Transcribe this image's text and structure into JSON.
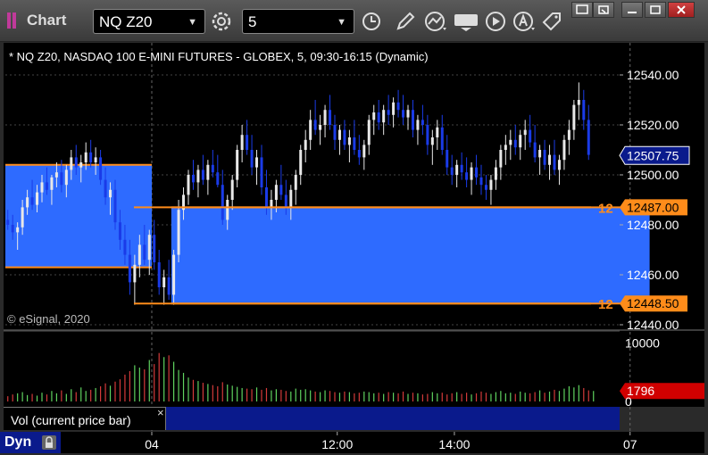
{
  "app": {
    "title": "Chart",
    "symbol": "NQ Z20",
    "interval": "5"
  },
  "chart_header": "* NQ Z20, NASDAQ 100 E-MINI FUTURES - GLOBEX, 5, 09:30-16:15 (Dynamic)",
  "copyright": "© eSignal, 2020",
  "volume_panel": {
    "label": "Vol (current price bar)",
    "close_symbol": "×"
  },
  "footer": {
    "dyn_label": "Dyn"
  },
  "colors": {
    "up": "#e8e8e8",
    "down": "#1a3be8",
    "zone": "#2e6bff",
    "level": "#ff8c1a",
    "vol_up": "#5fd35f",
    "vol_down": "#d43a3a",
    "last_price_bg": "#0a1a8c",
    "vol_badge": "#d00000"
  },
  "chart_data": {
    "type": "candlestick",
    "price_axis": {
      "ylim": [
        12440,
        12545
      ],
      "ticks": [
        "12540.00",
        "12520.00",
        "12500.00",
        "12480.00",
        "12460.00",
        "12440.00"
      ],
      "tick_values": [
        12540,
        12520,
        12500,
        12480,
        12460,
        12440
      ]
    },
    "volume_axis": {
      "ylim": [
        0,
        11000
      ],
      "ticks": [
        "10000",
        "0"
      ],
      "tick_values": [
        10000,
        0
      ]
    },
    "x_ticks": [
      {
        "label": "04",
        "index": 30
      },
      {
        "label": "12:00",
        "index": 68
      },
      {
        "label": "14:00",
        "index": 92
      },
      {
        "label": "07",
        "index": 128
      }
    ],
    "session_breaks": [
      30,
      128
    ],
    "levels": [
      {
        "tag": "12",
        "label": "12487.00",
        "value": 12487.0
      },
      {
        "tag": "12",
        "label": "12448.50",
        "value": 12448.5
      }
    ],
    "zones": [
      {
        "from": 0,
        "to": 29,
        "top": 12504,
        "bottom": 12463
      },
      {
        "from": 34,
        "to": 131,
        "top": 12487,
        "bottom": 12448.5
      }
    ],
    "last_price": {
      "label": "12507.75",
      "value": 12507.75
    },
    "last_volume": {
      "label": "1796",
      "value": 1796
    },
    "bars": [
      [
        12482,
        12486,
        12478,
        12480
      ],
      [
        12480,
        12484,
        12474,
        12477
      ],
      [
        12477,
        12481,
        12470,
        12479
      ],
      [
        12479,
        12490,
        12476,
        12487
      ],
      [
        12487,
        12494,
        12484,
        12491
      ],
      [
        12491,
        12498,
        12486,
        12488
      ],
      [
        12488,
        12496,
        12485,
        12493
      ],
      [
        12493,
        12500,
        12489,
        12497
      ],
      [
        12497,
        12503,
        12492,
        12494
      ],
      [
        12494,
        12500,
        12488,
        12499
      ],
      [
        12499,
        12505,
        12495,
        12501
      ],
      [
        12501,
        12506,
        12493,
        12496
      ],
      [
        12496,
        12504,
        12491,
        12502
      ],
      [
        12502,
        12510,
        12498,
        12507
      ],
      [
        12507,
        12512,
        12500,
        12503
      ],
      [
        12503,
        12508,
        12497,
        12505
      ],
      [
        12505,
        12513,
        12502,
        12509
      ],
      [
        12509,
        12514,
        12503,
        12505
      ],
      [
        12505,
        12511,
        12500,
        12507
      ],
      [
        12507,
        12510,
        12496,
        12498
      ],
      [
        12498,
        12503,
        12488,
        12491
      ],
      [
        12491,
        12497,
        12484,
        12494
      ],
      [
        12494,
        12498,
        12478,
        12481
      ],
      [
        12481,
        12486,
        12470,
        12474
      ],
      [
        12474,
        12480,
        12464,
        12468
      ],
      [
        12468,
        12474,
        12452,
        12457
      ],
      [
        12457,
        12468,
        12448,
        12464
      ],
      [
        12464,
        12476,
        12459,
        12472
      ],
      [
        12472,
        12480,
        12464,
        12466
      ],
      [
        12466,
        12478,
        12460,
        12476
      ],
      [
        12476,
        12482,
        12462,
        12465
      ],
      [
        12465,
        12470,
        12452,
        12455
      ],
      [
        12455,
        12462,
        12448,
        12459
      ],
      [
        12459,
        12466,
        12450,
        12452
      ],
      [
        12452,
        12470,
        12448,
        12468
      ],
      [
        12468,
        12490,
        12465,
        12486
      ],
      [
        12486,
        12495,
        12482,
        12492
      ],
      [
        12492,
        12502,
        12488,
        12500
      ],
      [
        12500,
        12506,
        12494,
        12497
      ],
      [
        12497,
        12504,
        12491,
        12502
      ],
      [
        12502,
        12508,
        12496,
        12498
      ],
      [
        12498,
        12506,
        12492,
        12504
      ],
      [
        12504,
        12510,
        12499,
        12501
      ],
      [
        12501,
        12508,
        12495,
        12496
      ],
      [
        12496,
        12502,
        12480,
        12482
      ],
      [
        12482,
        12492,
        12478,
        12490
      ],
      [
        12490,
        12500,
        12486,
        12498
      ],
      [
        12498,
        12512,
        12495,
        12510
      ],
      [
        12510,
        12520,
        12505,
        12516
      ],
      [
        12516,
        12522,
        12508,
        12510
      ],
      [
        12510,
        12516,
        12500,
        12503
      ],
      [
        12503,
        12510,
        12496,
        12507
      ],
      [
        12507,
        12512,
        12492,
        12495
      ],
      [
        12495,
        12502,
        12484,
        12487
      ],
      [
        12487,
        12494,
        12482,
        12490
      ],
      [
        12490,
        12498,
        12485,
        12496
      ],
      [
        12496,
        12504,
        12490,
        12492
      ],
      [
        12492,
        12498,
        12484,
        12487
      ],
      [
        12487,
        12496,
        12482,
        12494
      ],
      [
        12494,
        12502,
        12488,
        12500
      ],
      [
        12500,
        12512,
        12496,
        12510
      ],
      [
        12510,
        12518,
        12505,
        12514
      ],
      [
        12514,
        12526,
        12510,
        12522
      ],
      [
        12522,
        12530,
        12516,
        12518
      ],
      [
        12518,
        12524,
        12512,
        12520
      ],
      [
        12520,
        12528,
        12515,
        12526
      ],
      [
        12526,
        12532,
        12518,
        12520
      ],
      [
        12520,
        12524,
        12510,
        12514
      ],
      [
        12514,
        12520,
        12508,
        12518
      ],
      [
        12518,
        12522,
        12510,
        12512
      ],
      [
        12512,
        12518,
        12505,
        12515
      ],
      [
        12515,
        12522,
        12508,
        12510
      ],
      [
        12510,
        12516,
        12504,
        12507
      ],
      [
        12507,
        12514,
        12502,
        12512
      ],
      [
        12512,
        12524,
        12508,
        12522
      ],
      [
        12522,
        12528,
        12516,
        12525
      ],
      [
        12525,
        12530,
        12518,
        12521
      ],
      [
        12521,
        12528,
        12516,
        12526
      ],
      [
        12526,
        12532,
        12520,
        12524
      ],
      [
        12524,
        12531,
        12519,
        12529
      ],
      [
        12529,
        12534,
        12523,
        12526
      ],
      [
        12526,
        12532,
        12520,
        12523
      ],
      [
        12523,
        12528,
        12518,
        12526
      ],
      [
        12526,
        12530,
        12515,
        12518
      ],
      [
        12518,
        12524,
        12512,
        12522
      ],
      [
        12522,
        12528,
        12516,
        12520
      ],
      [
        12520,
        12524,
        12508,
        12512
      ],
      [
        12512,
        12518,
        12504,
        12515
      ],
      [
        12515,
        12522,
        12510,
        12519
      ],
      [
        12519,
        12524,
        12508,
        12510
      ],
      [
        12510,
        12516,
        12500,
        12503
      ],
      [
        12503,
        12508,
        12496,
        12500
      ],
      [
        12500,
        12506,
        12495,
        12504
      ],
      [
        12504,
        12509,
        12498,
        12501
      ],
      [
        12501,
        12507,
        12495,
        12498
      ],
      [
        12498,
        12505,
        12492,
        12503
      ],
      [
        12503,
        12508,
        12496,
        12499
      ],
      [
        12499,
        12504,
        12492,
        12496
      ],
      [
        12496,
        12500,
        12490,
        12494
      ],
      [
        12494,
        12500,
        12488,
        12498
      ],
      [
        12498,
        12506,
        12494,
        12503
      ],
      [
        12503,
        12512,
        12498,
        12510
      ],
      [
        12510,
        12516,
        12504,
        12512
      ],
      [
        12512,
        12518,
        12506,
        12514
      ],
      [
        12514,
        12520,
        12508,
        12511
      ],
      [
        12511,
        12518,
        12506,
        12516
      ],
      [
        12516,
        12522,
        12510,
        12518
      ],
      [
        12518,
        12524,
        12511,
        12513
      ],
      [
        12513,
        12520,
        12505,
        12507
      ],
      [
        12507,
        12512,
        12500,
        12510
      ],
      [
        12510,
        12514,
        12502,
        12504
      ],
      [
        12504,
        12512,
        12498,
        12508
      ],
      [
        12508,
        12514,
        12500,
        12502
      ],
      [
        12502,
        12508,
        12496,
        12506
      ],
      [
        12506,
        12516,
        12502,
        12514
      ],
      [
        12514,
        12522,
        12508,
        12518
      ],
      [
        12518,
        12530,
        12514,
        12528
      ],
      [
        12528,
        12537,
        12522,
        12530
      ],
      [
        12530,
        12534,
        12518,
        12522
      ],
      [
        12522,
        12528,
        12506,
        12508
      ]
    ],
    "volumes": [
      900,
      1200,
      1400,
      1600,
      1100,
      1300,
      1000,
      1500,
      1200,
      1800,
      1400,
      1900,
      1300,
      2100,
      1600,
      2400,
      1800,
      2000,
      2300,
      2600,
      3100,
      2700,
      3400,
      3800,
      4600,
      5200,
      6200,
      5800,
      5500,
      7100,
      6400,
      8300,
      7600,
      7900,
      6800,
      5400,
      4900,
      4100,
      3700,
      3500,
      3200,
      3000,
      2800,
      2600,
      3300,
      2900,
      2700,
      2500,
      2300,
      2200,
      2100,
      2400,
      2000,
      2300,
      1900,
      2100,
      2000,
      1800,
      1700,
      2200,
      2000,
      2100,
      1900,
      1700,
      1600,
      1900,
      1800,
      1600,
      1500,
      1700,
      1600,
      1400,
      1500,
      1700,
      1600,
      1400,
      1500,
      1300,
      1600,
      1500,
      1400,
      1700,
      1300,
      1500,
      1400,
      1200,
      1300,
      1600,
      1400,
      1500,
      1200,
      1400,
      1600,
      1300,
      1500,
      1200,
      1400,
      1700,
      1500,
      1300,
      1600,
      1800,
      1400,
      1500,
      1300,
      1700,
      1500,
      1400,
      1600,
      1900,
      1500,
      1700,
      2000,
      1800,
      2200,
      2600,
      2400,
      2800,
      2300,
      1900,
      1796
    ]
  }
}
